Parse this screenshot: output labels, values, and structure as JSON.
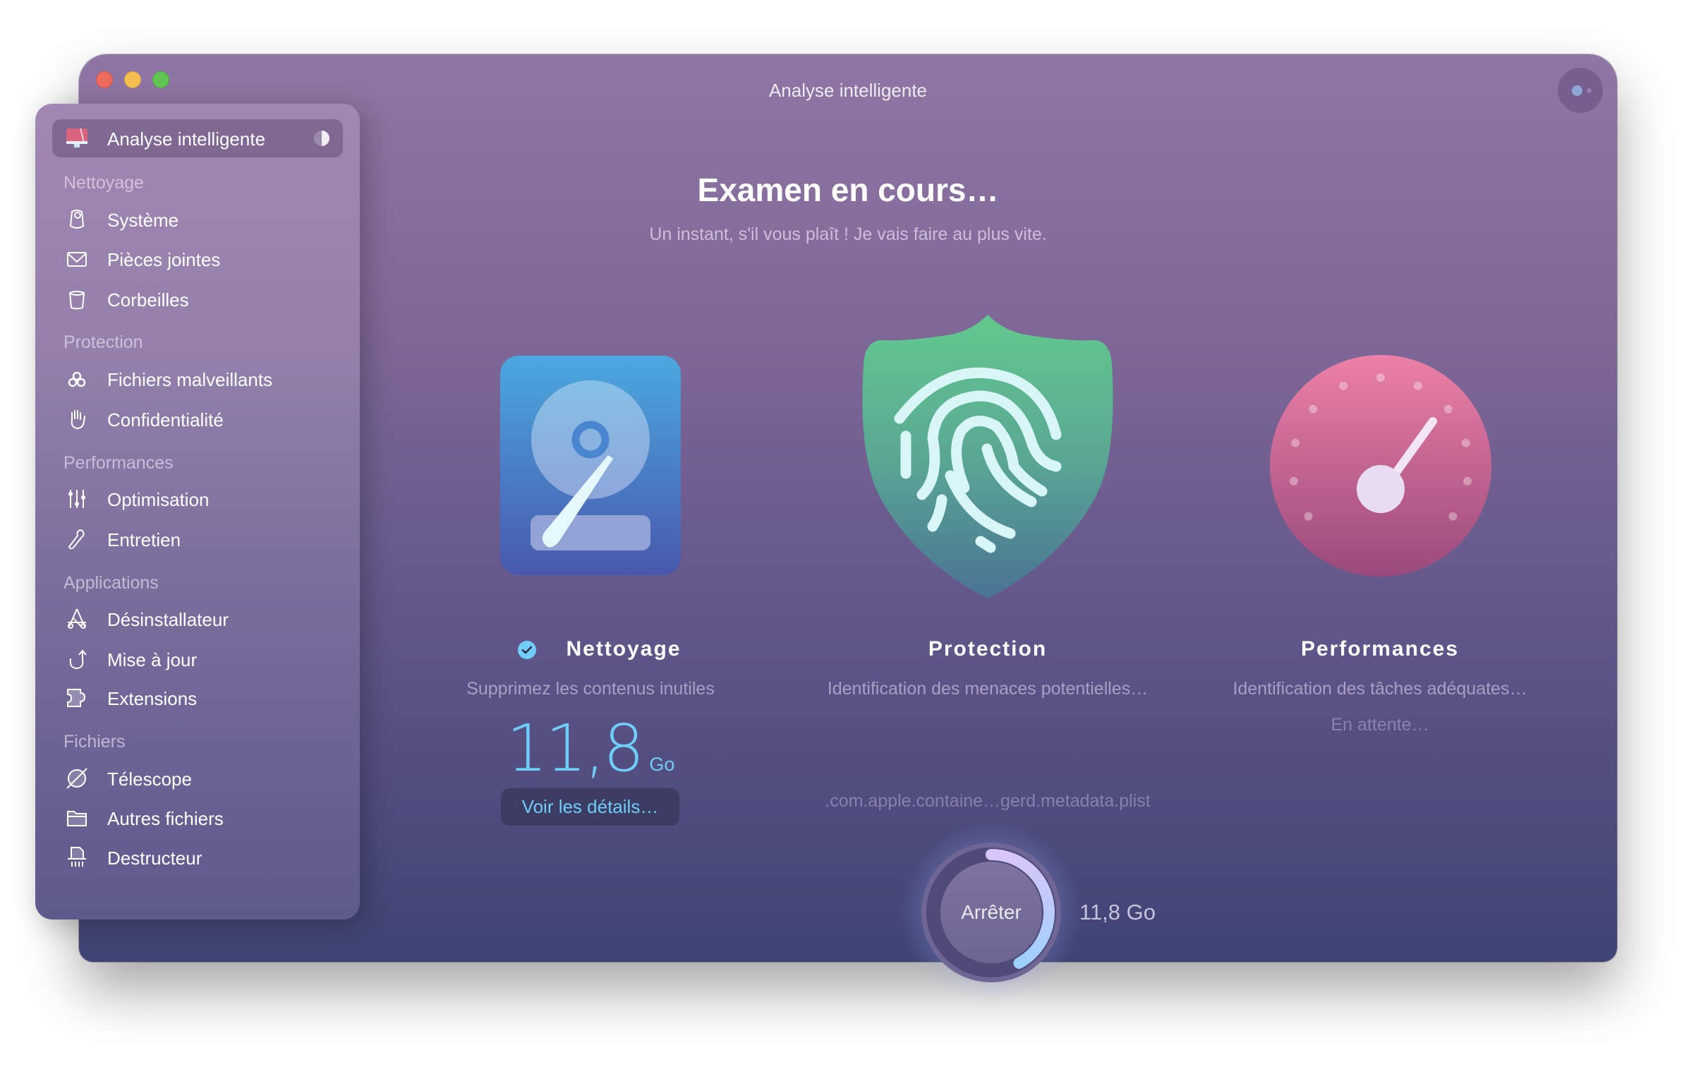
{
  "window": {
    "title": "Analyse intelligente",
    "traffic_lights": [
      "close",
      "minimize",
      "zoom"
    ],
    "assistant_button_icon": "assistant-dots-icon"
  },
  "sidebar": {
    "selected": {
      "label": "Analyse intelligente",
      "icon": "monitor-icon",
      "badge_icon": "progress-pie-icon"
    },
    "sections": [
      {
        "header": "Nettoyage",
        "items": [
          {
            "label": "Système",
            "icon": "system-junk-icon"
          },
          {
            "label": "Pièces jointes",
            "icon": "envelope-icon"
          },
          {
            "label": "Corbeilles",
            "icon": "trash-bin-icon"
          }
        ]
      },
      {
        "header": "Protection",
        "items": [
          {
            "label": "Fichiers malveillants",
            "icon": "biohazard-icon"
          },
          {
            "label": "Confidentialité",
            "icon": "hand-icon"
          }
        ]
      },
      {
        "header": "Performances",
        "items": [
          {
            "label": "Optimisation",
            "icon": "sliders-icon"
          },
          {
            "label": "Entretien",
            "icon": "wrench-icon"
          }
        ]
      },
      {
        "header": "Applications",
        "items": [
          {
            "label": "Désinstallateur",
            "icon": "app-store-icon"
          },
          {
            "label": "Mise à jour",
            "icon": "update-arrow-icon"
          },
          {
            "label": "Extensions",
            "icon": "puzzle-icon"
          }
        ]
      },
      {
        "header": "Fichiers",
        "items": [
          {
            "label": "Télescope",
            "icon": "planet-icon"
          },
          {
            "label": "Autres fichiers",
            "icon": "folder-icon"
          },
          {
            "label": "Destructeur",
            "icon": "shredder-icon"
          }
        ]
      }
    ]
  },
  "main": {
    "title": "Examen en cours…",
    "subtitle": "Un instant, s'il vous plaît ! Je vais faire au plus vite.",
    "columns": [
      {
        "title": "Nettoyage",
        "done": true,
        "subtitle": "Supprimez les contenus inutiles",
        "size_value": "11,8",
        "size_unit": "Go",
        "button": "Voir les détails…",
        "illustration": "hard-drive-icon"
      },
      {
        "title": "Protection",
        "subtitle": "Identification des menaces potentielles…",
        "status": ".com.apple.containe…gerd.metadata.plist",
        "illustration": "shield-fingerprint-icon"
      },
      {
        "title": "Performances",
        "subtitle": "Identification des tâches adéquates…",
        "status": "En attente…",
        "illustration": "speed-gauge-icon"
      }
    ],
    "stop_button": "Arrêter",
    "progress_fraction": 0.42,
    "total_size": "11,8 Go"
  },
  "colors": {
    "accent_blue": "#6fcdf7",
    "close": "#ec6a5e",
    "minimize": "#f4bf4f",
    "zoom": "#61c554"
  }
}
